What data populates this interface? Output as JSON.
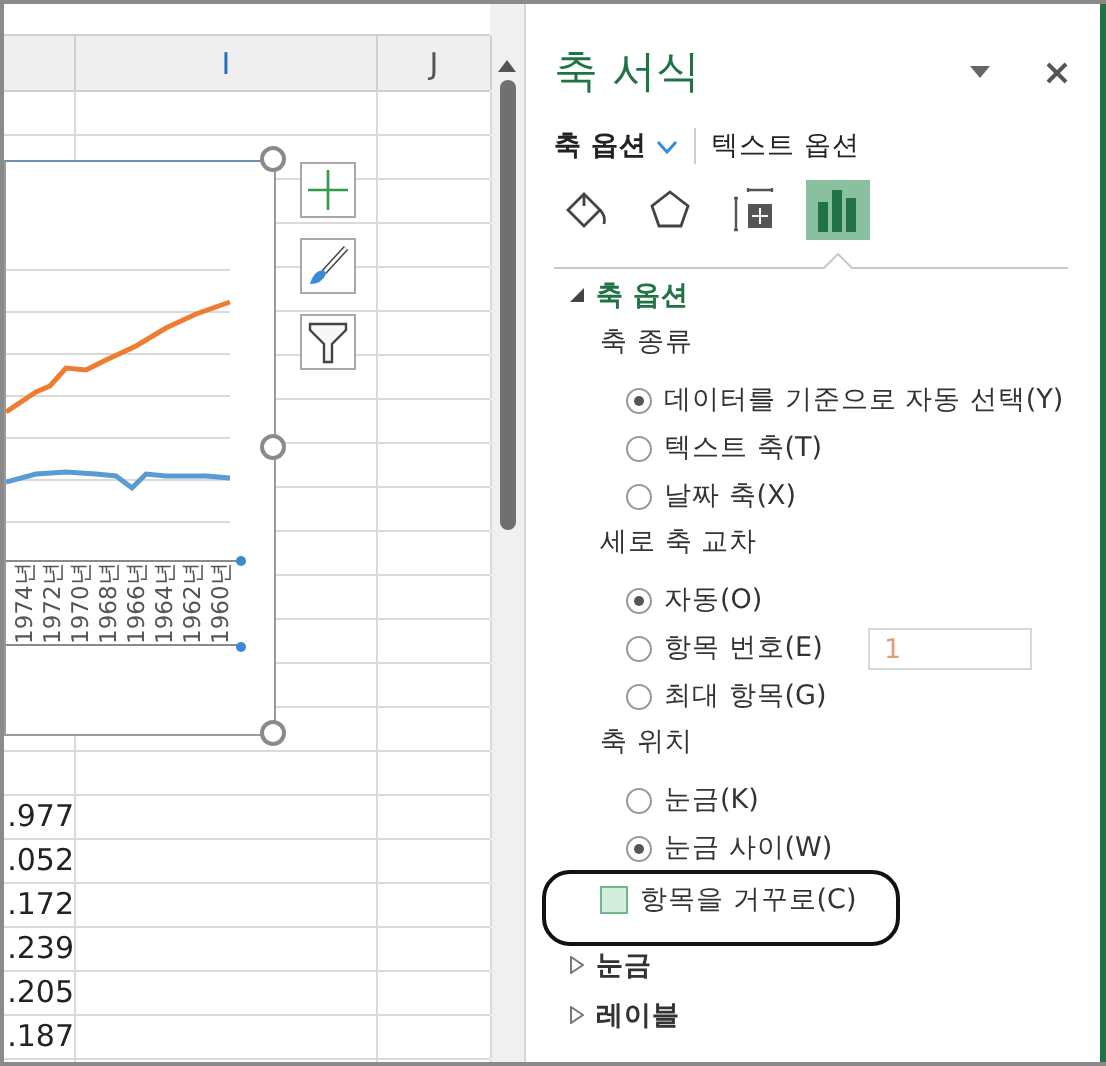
{
  "sheet": {
    "column_headers": [
      {
        "label": "I",
        "selected": true
      },
      {
        "label": "J",
        "selected": false
      }
    ],
    "cells": [
      ".977",
      ".052",
      ".172",
      ".239",
      ".205",
      ".187"
    ]
  },
  "chart": {
    "axis_labels": [
      "1974년",
      "1972년",
      "1970년",
      "1968년",
      "1966년",
      "1964년",
      "1962년",
      "1960년"
    ]
  },
  "panel": {
    "title": "축 서식",
    "tabs": [
      {
        "label": "축 옵션",
        "selected": true
      },
      {
        "label": "텍스트 옵션",
        "selected": false
      }
    ],
    "icon_tabs": [
      {
        "kind": "fill",
        "selected": false
      },
      {
        "kind": "effects",
        "selected": false
      },
      {
        "kind": "size",
        "selected": false
      },
      {
        "kind": "options",
        "selected": true
      }
    ],
    "sections": [
      {
        "label": "축 옵션",
        "expanded": true,
        "groups": [
          {
            "label": "축 종류",
            "options": [
              {
                "label": "데이터를 기준으로 자동 선택(Y)",
                "selected": true
              },
              {
                "label": "텍스트 축(T)",
                "selected": false
              },
              {
                "label": "날짜 축(X)",
                "selected": false
              }
            ]
          },
          {
            "label": "세로 축 교차",
            "options": [
              {
                "label": "자동(O)",
                "selected": true
              },
              {
                "label": "항목 번호(E)",
                "selected": false,
                "value": "1"
              },
              {
                "label": "최대 항목(G)",
                "selected": false
              }
            ]
          },
          {
            "label": "축 위치",
            "options": [
              {
                "label": "눈금(K)",
                "selected": false
              },
              {
                "label": "눈금 사이(W)",
                "selected": true
              }
            ]
          }
        ],
        "checkbox": {
          "label": "항목을 거꾸로(C)",
          "checked": false,
          "highlighted": true
        }
      },
      {
        "label": "눈금",
        "expanded": false
      },
      {
        "label": "레이블",
        "expanded": false
      }
    ]
  }
}
